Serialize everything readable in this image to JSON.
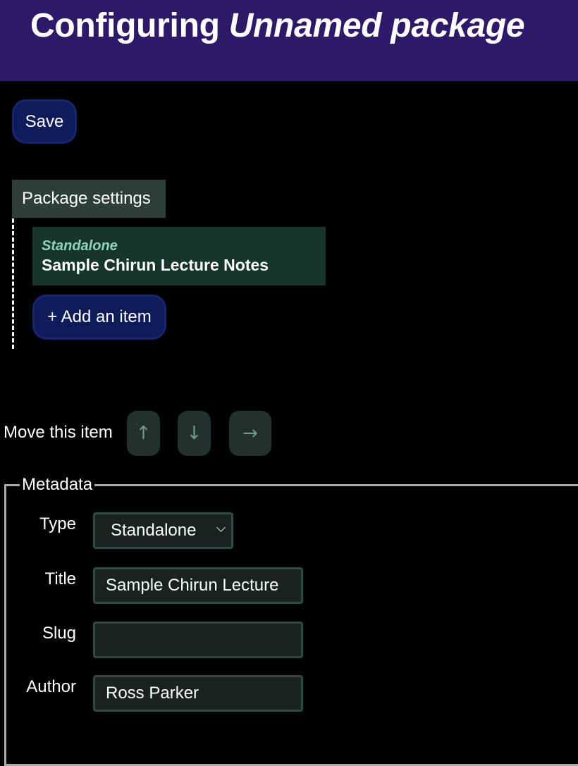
{
  "header": {
    "title_prefix": "Configuring",
    "package_name": "Unnamed package"
  },
  "toolbar": {
    "save_label": "Save"
  },
  "tree": {
    "package_settings_label": "Package settings",
    "items": [
      {
        "type": "Standalone",
        "title": "Sample Chirun Lecture Notes"
      }
    ],
    "add_item_label": "+ Add an item"
  },
  "move": {
    "label": "Move this item",
    "up_icon": "↑",
    "down_icon": "↓",
    "right_icon": "→"
  },
  "metadata": {
    "legend": "Metadata",
    "type": {
      "label": "Type",
      "value": "Standalone"
    },
    "title": {
      "label": "Title",
      "value": "Sample Chirun Lecture"
    },
    "slug": {
      "label": "Slug",
      "value": ""
    },
    "author": {
      "label": "Author",
      "value": "Ross Parker"
    }
  },
  "colors": {
    "header_bg": "#2e1868",
    "button_bg": "#101b5c",
    "item_bg": "#17342e",
    "item_type": "#8fd3bd"
  }
}
